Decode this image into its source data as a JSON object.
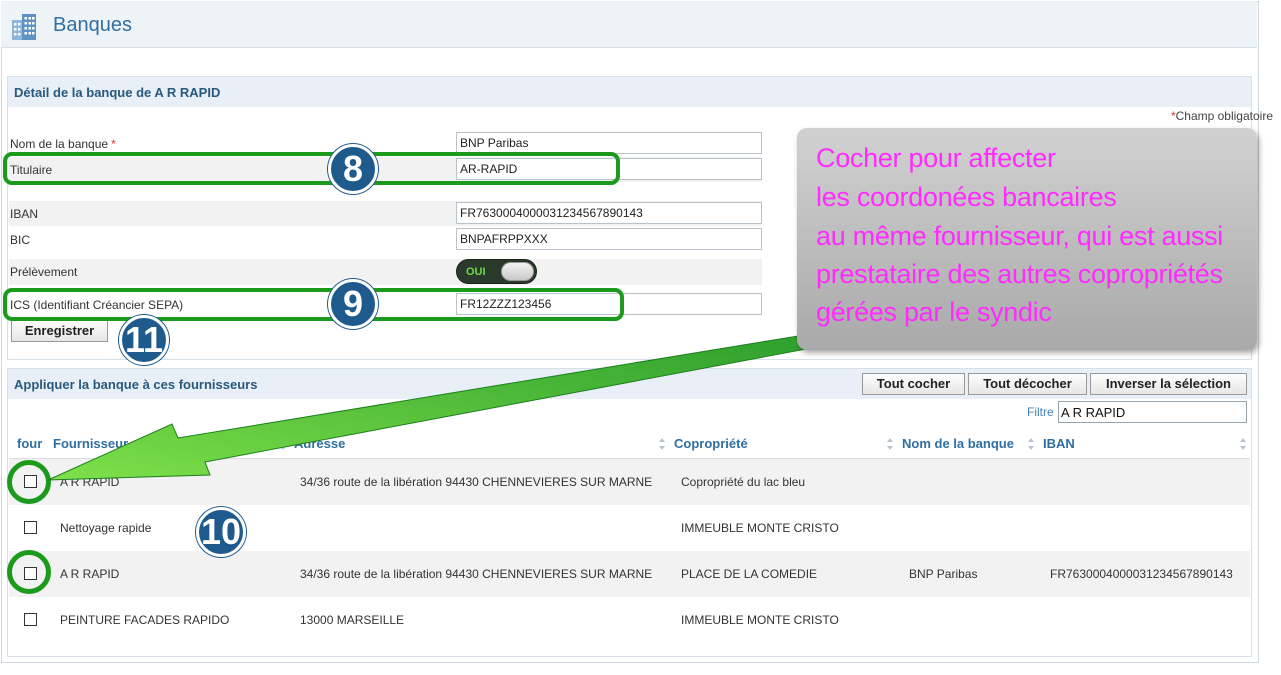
{
  "page": {
    "title": "Banques"
  },
  "icons": {
    "header": "bank-building-icon"
  },
  "colors": {
    "accent": "#2f6fa3",
    "highlight": "#1c9a1c",
    "badge": "#1f5a8c",
    "callout_text": "#ff2bff"
  },
  "detail": {
    "title": "Détail de la banque de A R RAPID",
    "required_note": "Champ obligatoire",
    "required_star": "*",
    "fields": {
      "bank_name": {
        "label": "Nom de la banque",
        "value": "BNP Paribas"
      },
      "holder": {
        "label": "Titulaire",
        "value": "AR-RAPID"
      },
      "iban": {
        "label": "IBAN",
        "value": "FR7630004000031234567890143"
      },
      "bic": {
        "label": "BIC",
        "value": "BNPAFRPPXXX"
      },
      "direct_debit": {
        "label": "Prélèvement",
        "value": "OUI",
        "enabled": true
      },
      "ics": {
        "label": "ICS (Identifiant Créancier SEPA)",
        "value": "FR12ZZZ123456"
      }
    },
    "save_label": "Enregistrer"
  },
  "suppliers": {
    "title": "Appliquer la banque à ces fournisseurs",
    "buttons": {
      "check_all": "Tout cocher",
      "uncheck_all": "Tout décocher",
      "invert": "Inverser la sélection"
    },
    "filter": {
      "label": "Filtre",
      "value": "A R RAPID"
    },
    "columns": {
      "four": "four",
      "supplier": "Fournisseur",
      "address": "Adresse",
      "copro": "Copropriété",
      "bank": "Nom de la banque",
      "iban": "IBAN"
    },
    "rows": [
      {
        "checked": false,
        "supplier": "A R RAPID",
        "address": "34/36 route de la libération 94430 CHENNEVIERES SUR MARNE",
        "copro": "Copropriété du lac bleu",
        "bank": "",
        "iban": ""
      },
      {
        "checked": false,
        "supplier": "Nettoyage rapide",
        "address": "",
        "copro": "IMMEUBLE MONTE CRISTO",
        "bank": "",
        "iban": ""
      },
      {
        "checked": false,
        "supplier": "A R RAPID",
        "address": "34/36 route de la libération 94430 CHENNEVIERES SUR MARNE",
        "copro": "PLACE DE LA COMEDIE",
        "bank": "BNP Paribas",
        "iban": "FR7630004000031234567890143"
      },
      {
        "checked": false,
        "supplier": "PEINTURE FACADES RAPIDO",
        "address": "13000 MARSEILLE",
        "copro": "IMMEUBLE MONTE CRISTO",
        "bank": "",
        "iban": ""
      }
    ]
  },
  "annotations": {
    "badges": [
      "8",
      "9",
      "10",
      "11"
    ],
    "callout": [
      "Cocher pour affecter",
      "les coordonées bancaires",
      "au même fournisseur, qui est aussi",
      "prestataire des autres copropriétés",
      "gérées par le syndic"
    ]
  }
}
